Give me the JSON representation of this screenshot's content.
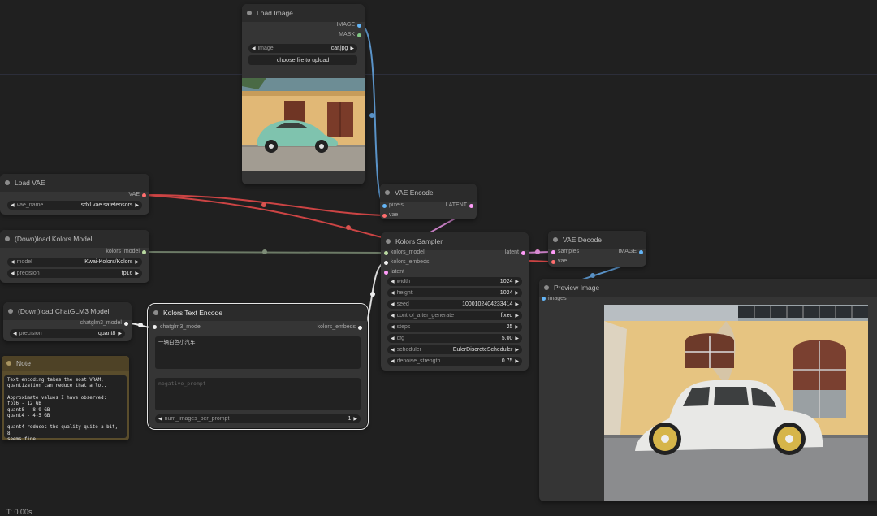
{
  "status": {
    "time": "T: 0.00s"
  },
  "load_image": {
    "title": "Load Image",
    "outputs": [
      "IMAGE",
      "MASK"
    ],
    "image_label": "image",
    "image_value": "car.jpg",
    "upload_button": "choose file to upload"
  },
  "load_vae": {
    "title": "Load VAE",
    "output": "VAE",
    "widget_label": "vae_name",
    "widget_value": "sdxl.vae.safetensors"
  },
  "load_kolors": {
    "title": "(Down)load Kolors Model",
    "output": "kolors_model",
    "model_label": "model",
    "model_value": "Kwai-Kolors/Kolors",
    "precision_label": "precision",
    "precision_value": "fp16"
  },
  "load_chatglm": {
    "title": "(Down)load ChatGLM3 Model",
    "output": "chatglm3_model",
    "precision_label": "precision",
    "precision_value": "quant8"
  },
  "note": {
    "title": "Note",
    "lines": [
      "Text encoding takes the most VRAM,",
      "quantization can reduce that a lot.",
      "",
      "Approximate values I have observed:",
      "fp16 - 12 GB",
      "quant8 - 8-9 GB",
      "quant4 - 4-5 GB",
      "",
      "quant4 reduces the quality quite a bit, 8",
      "seems fine"
    ]
  },
  "text_encode": {
    "title": "Kolors Text Encode",
    "input": "chatglm3_model",
    "output": "kolors_embeds",
    "prompt": "一辆白色小汽车",
    "negative_placeholder": "negative_prompt",
    "num_label": "num_images_per_prompt",
    "num_value": "1"
  },
  "vae_encode": {
    "title": "VAE Encode",
    "inputs": [
      "pixels",
      "vae"
    ],
    "output": "LATENT"
  },
  "sampler": {
    "title": "Kolors Sampler",
    "inputs": [
      "kolors_model",
      "kolors_embeds",
      "latent"
    ],
    "output": "latent",
    "widgets": [
      {
        "label": "width",
        "value": "1024"
      },
      {
        "label": "height",
        "value": "1024"
      },
      {
        "label": "seed",
        "value": "1000102404233414"
      },
      {
        "label": "control_after_generate",
        "value": "fixed"
      },
      {
        "label": "steps",
        "value": "25"
      },
      {
        "label": "cfg",
        "value": "5.00"
      },
      {
        "label": "scheduler",
        "value": "EulerDiscreteScheduler"
      },
      {
        "label": "denoise_strength",
        "value": "0.75"
      }
    ]
  },
  "vae_decode": {
    "title": "VAE Decode",
    "inputs": [
      "samples",
      "vae"
    ],
    "output": "IMAGE"
  },
  "preview": {
    "title": "Preview Image",
    "input": "images"
  },
  "colors": {
    "image": "#64b5f6",
    "vae": "#ff6e6e",
    "latent": "#ff9cf9",
    "model": "#b8d8a0",
    "embeds": "#f0f0f0"
  }
}
